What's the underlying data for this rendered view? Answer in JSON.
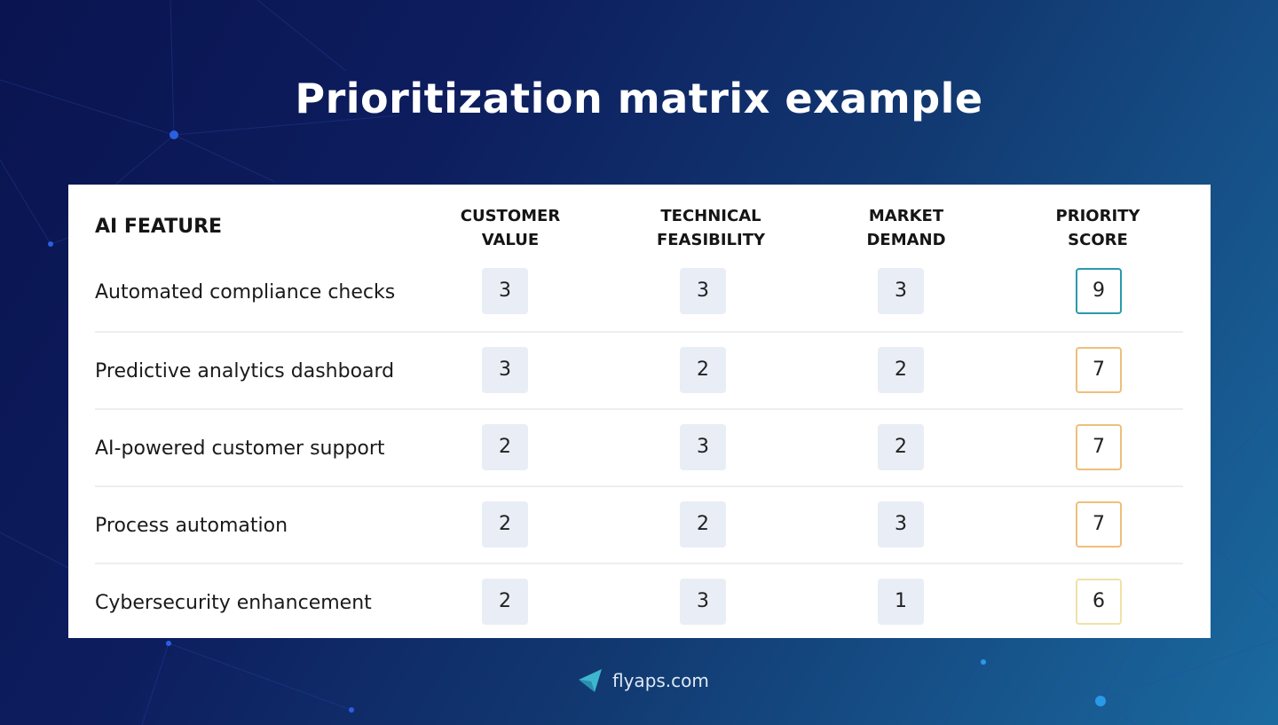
{
  "title": "Prioritization matrix example",
  "table": {
    "headers": {
      "feature": "AI FEATURE",
      "columns": [
        {
          "line1": "CUSTOMER",
          "line2": "VALUE"
        },
        {
          "line1": "TECHNICAL",
          "line2": "FEASIBILITY"
        },
        {
          "line1": "MARKET",
          "line2": "DEMAND"
        },
        {
          "line1": "PRIORITY",
          "line2": "SCORE"
        }
      ]
    },
    "rows": [
      {
        "feature": "Automated compliance checks",
        "customer_value": "3",
        "technical_feasibility": "3",
        "market_demand": "3",
        "priority_score": "9",
        "score_color": "#2a9aa8"
      },
      {
        "feature": "Predictive analytics dashboard",
        "customer_value": "3",
        "technical_feasibility": "2",
        "market_demand": "2",
        "priority_score": "7",
        "score_color": "#efbf7a"
      },
      {
        "feature": "AI-powered customer support",
        "customer_value": "2",
        "technical_feasibility": "3",
        "market_demand": "2",
        "priority_score": "7",
        "score_color": "#efbf7a"
      },
      {
        "feature": "Process automation",
        "customer_value": "2",
        "technical_feasibility": "2",
        "market_demand": "3",
        "priority_score": "7",
        "score_color": "#efbf7a"
      },
      {
        "feature": "Cybersecurity enhancement",
        "customer_value": "2",
        "technical_feasibility": "3",
        "market_demand": "1",
        "priority_score": "6",
        "score_color": "#f1e1a8"
      }
    ]
  },
  "footer": {
    "logo_icon": "paper-plane-icon",
    "brand": "flyaps.com"
  },
  "colors": {
    "cell_bg": "#e9edf5",
    "score_high": "#2a9aa8",
    "score_mid": "#efbf7a",
    "score_low": "#f1e1a8"
  }
}
